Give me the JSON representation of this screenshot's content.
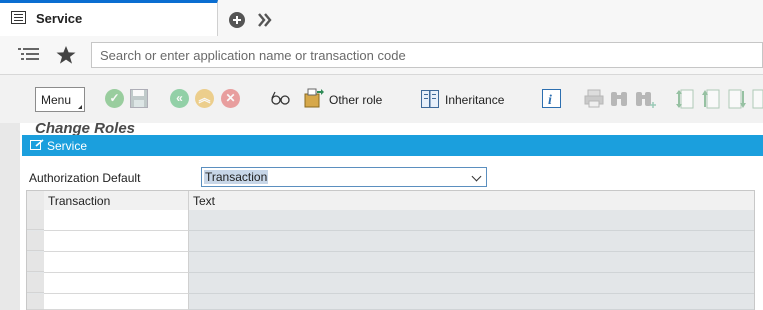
{
  "tab": {
    "title": "Service"
  },
  "search": {
    "placeholder": "Search or enter application name or transaction code"
  },
  "toolbar": {
    "menu_label": "Menu",
    "other_role_label": "Other role",
    "inheritance_label": "Inheritance",
    "icons": [
      "check-icon",
      "save-icon",
      "back-icon",
      "up-icon",
      "cancel-icon",
      "glasses-icon",
      "other-role-icon",
      "inheritance-icon",
      "info-icon",
      "print-icon",
      "find-icon",
      "find-next-icon",
      "first-page-icon",
      "previous-page-icon",
      "next-page-icon",
      "last-page-icon"
    ]
  },
  "page": {
    "title": "Change Roles"
  },
  "panel": {
    "title": "Service",
    "auth_default_label": "Authorization Default",
    "auth_default_value": "Transaction"
  },
  "table": {
    "columns": [
      "Transaction",
      "Text"
    ],
    "rows": [
      [
        "",
        ""
      ],
      [
        "",
        ""
      ],
      [
        "",
        ""
      ],
      [
        "",
        ""
      ],
      [
        "",
        ""
      ]
    ]
  },
  "colors": {
    "accent": "#1b9fdd",
    "ok": "#6cbf6e",
    "back": "#f0c35a",
    "cancel": "#e57373"
  }
}
